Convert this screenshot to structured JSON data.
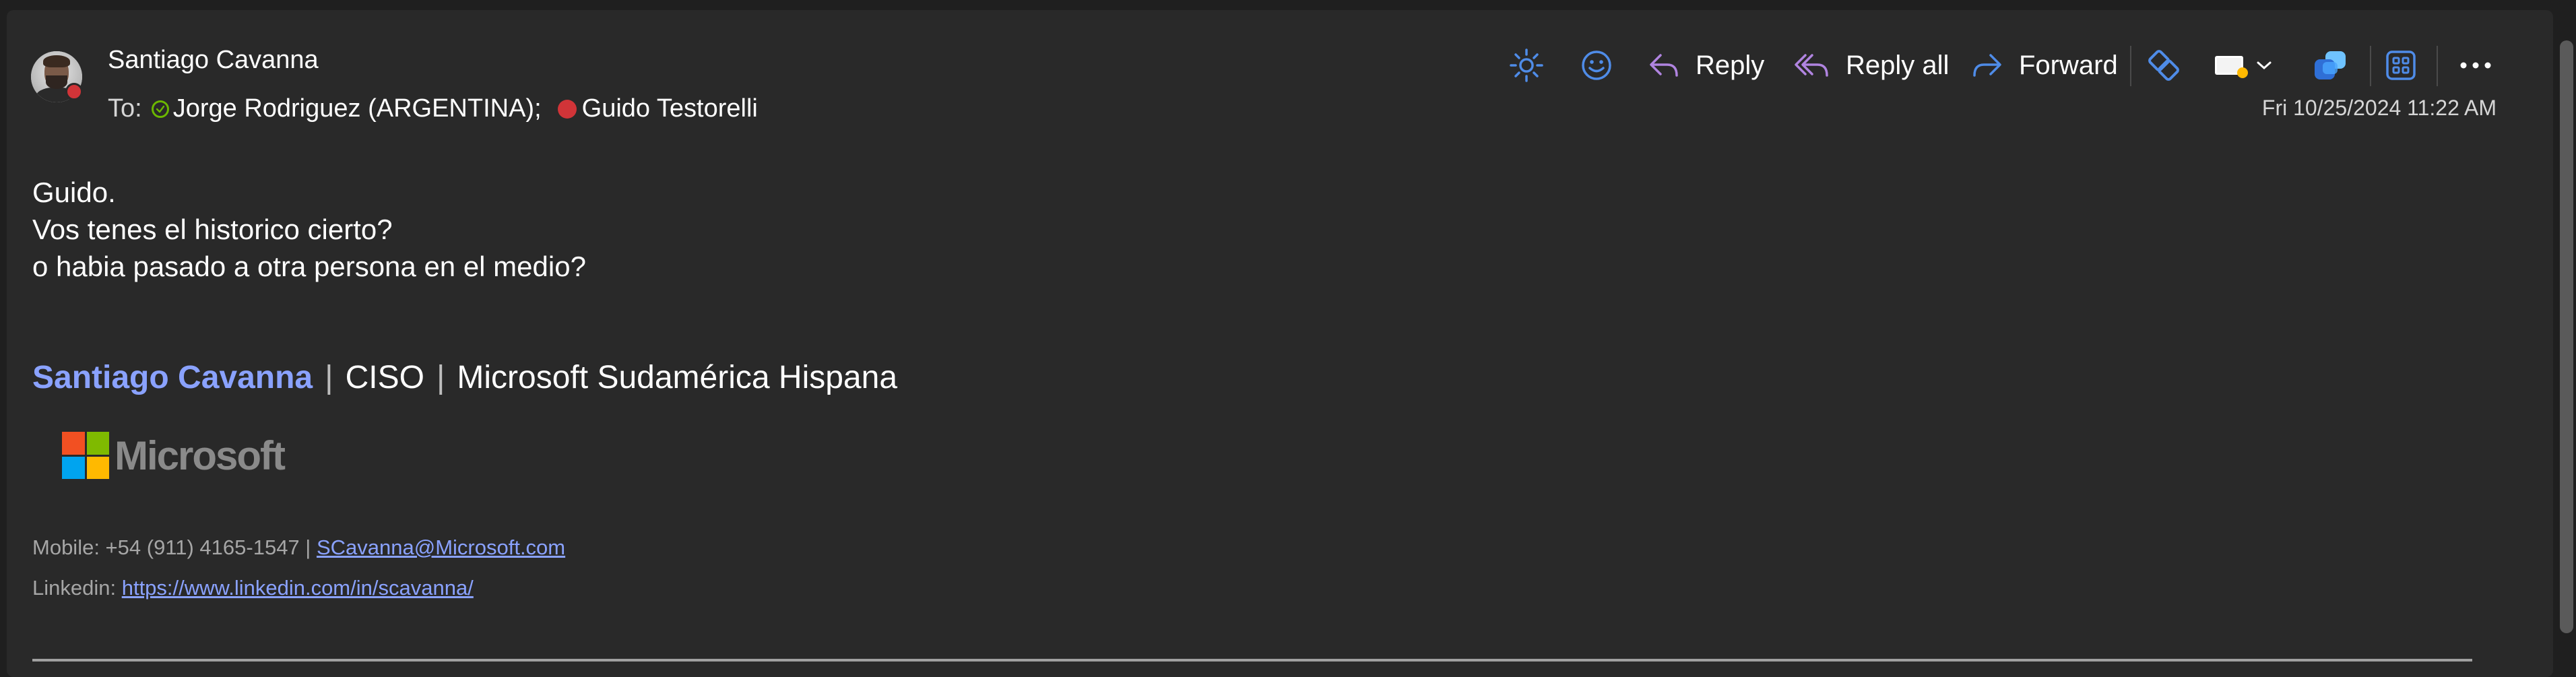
{
  "message": {
    "sender": "Santiago Cavanna",
    "to_label": "To:",
    "recipients": [
      {
        "name": "Jorge Rodriguez (ARGENTINA);",
        "status": "available"
      },
      {
        "name": "Guido Testorelli",
        "status": "busy"
      }
    ],
    "timestamp": "Fri 10/25/2024 11:22 AM"
  },
  "toolbar": {
    "reply_label": "Reply",
    "reply_all_label": "Reply all",
    "forward_label": "Forward",
    "icons": [
      "sun-icon",
      "emoji-icon",
      "reply-icon",
      "reply-all-icon",
      "forward-icon",
      "loop-icon",
      "label-icon",
      "chevron-down-icon",
      "teams-icon",
      "apps-icon",
      "more-icon"
    ]
  },
  "body": {
    "lines": [
      "Guido.",
      "Vos tenes el historico cierto?",
      "o habia pasado a otra persona en el medio?"
    ]
  },
  "signature": {
    "name": "Santiago Cavanna",
    "separator": "|",
    "role": "CISO",
    "org": "Microsoft Sudamérica Hispana",
    "logo_text": "Microsoft",
    "mobile_prefix": "Mobile: +54 (911) 4165-1547 |",
    "email": "SCavanna@Microsoft.com",
    "linkedin_label": "Linkedin:",
    "linkedin_url": "https://www.linkedin.com/in/scavanna/"
  },
  "colors": {
    "background": "#292929",
    "accent_link": "#8aa2ff",
    "icon_blue": "#4f8ce8",
    "icon_purple": "#b084e0",
    "presence_busy": "#d13438",
    "presence_available": "#6bb700"
  }
}
